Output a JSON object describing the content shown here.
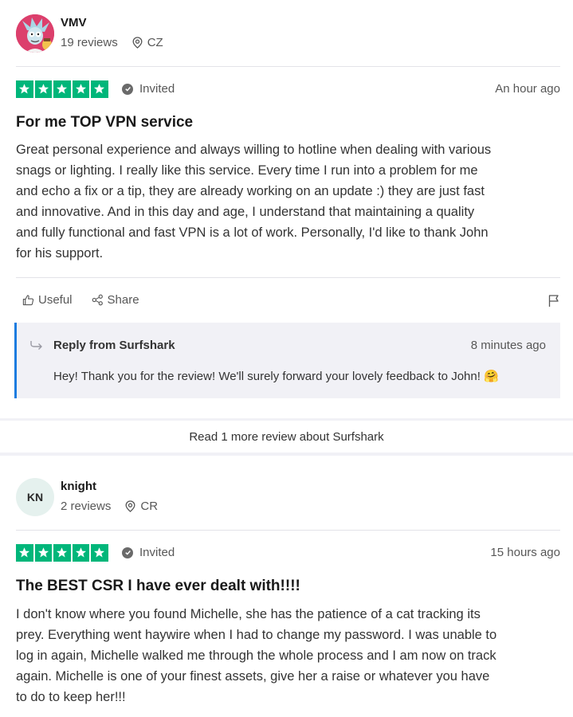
{
  "reviews": [
    {
      "user_name": "VMV",
      "review_count": "19 reviews",
      "location": "CZ",
      "rating": 5,
      "invited_label": "Invited",
      "date": "An hour ago",
      "title": "For me TOP VPN service",
      "body": [
        "Great personal experience and always willing to hotline when dealing with various",
        "snags or lighting. I really like this service. Every time I run into a problem for me",
        "and echo a fix or a tip, they are already working on an update :) they are just fast",
        "and innovative. And in this day and age, I understand that maintaining a quality",
        "and fully functional and fast VPN is a lot of work. Personally, I'd like to thank John",
        "for his support."
      ],
      "actions": {
        "useful": "Useful",
        "share": "Share"
      },
      "reply": {
        "from": "Reply from Surfshark",
        "date": "8 minutes ago",
        "text": "Hey! Thank you for the review! We'll surely forward your lovely feedback to John! 🤗"
      }
    },
    {
      "user_name": "knight",
      "initials": "KN",
      "review_count": "2 reviews",
      "location": "CR",
      "rating": 5,
      "invited_label": "Invited",
      "date": "15 hours ago",
      "title": "The BEST CSR I have ever dealt with!!!!",
      "body": [
        "I don't know where you found Michelle, she has the patience of a cat tracking its",
        "prey. Everything went haywire when I had to change my password. I was unable to",
        "log in again, Michelle walked me through the whole process and I am now on track",
        "again. Michelle is one of your finest assets, give her a raise or whatever you have",
        "to do to keep her!!!"
      ]
    }
  ],
  "read_more": "Read 1 more review about Surfshark",
  "colors": {
    "star_green": "#00b67a",
    "reply_accent": "#1b7ce0",
    "page_bg": "#f1f1f6",
    "avatar_pink": "#dc3f6c",
    "avatar_mint": "#e5f1ee"
  },
  "icons": [
    "location-pin-icon",
    "verified-check-icon",
    "star-icon",
    "thumbs-up-icon",
    "share-icon",
    "flag-icon",
    "reply-arrow-icon"
  ]
}
